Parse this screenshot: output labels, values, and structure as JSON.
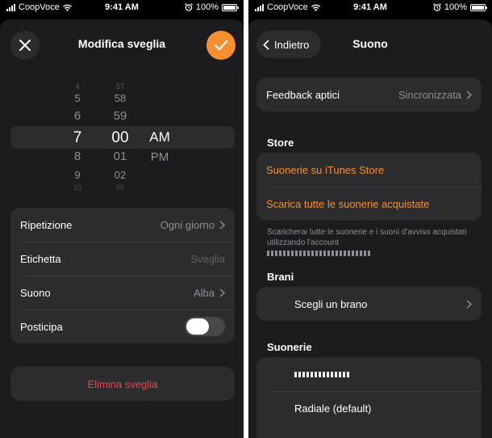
{
  "status": {
    "carrier": "CoopVoce",
    "time": "9:41 AM",
    "battery": "100%",
    "battery_level": 1.0
  },
  "left": {
    "title": "Modifica sveglia",
    "picker": {
      "hours": [
        "4",
        "5",
        "6",
        "7",
        "8",
        "9",
        "10"
      ],
      "minutes": [
        "57",
        "58",
        "59",
        "00",
        "01",
        "02",
        "03"
      ],
      "periods": [
        "AM",
        "PM"
      ],
      "selected": {
        "hour": "7",
        "minute": "00",
        "period": "AM"
      }
    },
    "rows": {
      "repeat": {
        "label": "Ripetizione",
        "value": "Ogni giorno"
      },
      "label": {
        "label": "Etichetta",
        "placeholder": "Sveglia"
      },
      "sound": {
        "label": "Suono",
        "value": "Alba"
      },
      "snooze": {
        "label": "Posticipa",
        "on": true
      }
    },
    "delete_label": "Elimina sveglia",
    "accent": "#f4902f",
    "destructive": "#e5484d"
  },
  "right": {
    "back_label": "Indietro",
    "title": "Suono",
    "haptics": {
      "label": "Feedback aptici",
      "value": "Sincronizzata"
    },
    "store_header": "Store",
    "store_links": [
      "Suonerie su iTunes Store",
      "Scarica tutte le suonerie acquistate"
    ],
    "store_footer": "Scaricherai tutte le suonerie e i suoni d'avviso acquistati utilizzando l'account",
    "songs_header": "Brani",
    "choose_song": "Scegli un brano",
    "ringtones_header": "Suonerie",
    "ringtones": [
      "Radiale (default)"
    ]
  },
  "icons": [
    "close-icon",
    "checkmark-icon",
    "chevron-right-icon",
    "chevron-left-icon",
    "wifi-icon",
    "alarm-icon",
    "battery-icon",
    "signal-icon"
  ]
}
